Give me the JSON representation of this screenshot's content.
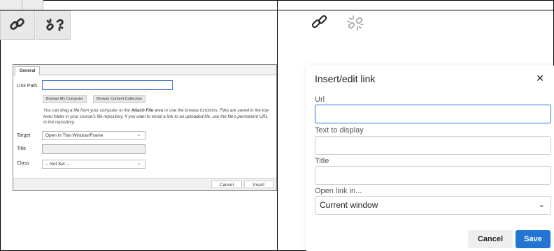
{
  "icons": {
    "left_tiles": [
      "link-icon",
      "unlink-icon"
    ],
    "right": [
      "link-icon",
      "unlink-icon"
    ]
  },
  "legacy_dialog": {
    "tab": "General",
    "link_path_label": "Link Path",
    "browse_computer": "Browse My Computer",
    "browse_collection": "Browse Content Collection",
    "help_pre": "You can drag a file from your computer to the ",
    "help_bold": "Attach File",
    "help_post": " area or use the browse functions. Files are saved in the top-level folder in your course's file repository. If you want to email a link to an uploaded file, use the file's permanent URL in the repository.",
    "target_label": "Target",
    "target_value": "Open in This Window/Frame",
    "title_label": "Title",
    "class_label": "Class",
    "class_value": "-- Not Set --",
    "cancel": "Cancel",
    "insert": "Insert"
  },
  "modern_dialog": {
    "title": "Insert/edit link",
    "close": "✕",
    "url_label": "Url",
    "text_label": "Text to display",
    "title_label": "Title",
    "open_label": "Open link in...",
    "open_value": "Current window",
    "cancel": "Cancel",
    "save": "Save",
    "accent": "#2276d2"
  }
}
